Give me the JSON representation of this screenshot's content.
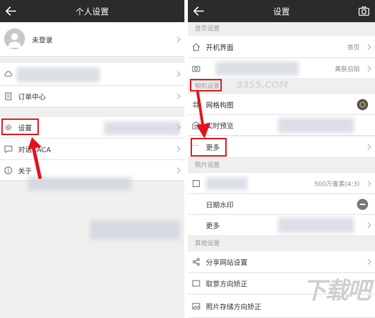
{
  "left": {
    "title": "个人设置",
    "login_text": "未登录",
    "orders": "订单中心",
    "settings": "设置",
    "chat": "对话CACA",
    "about": "关于"
  },
  "right": {
    "title": "设置",
    "section_home": "首页设置",
    "boot_screen": "开机界面",
    "boot_screen_value": "首页",
    "beauty_value": "美肤自拍",
    "section_camera": "相机设置",
    "grid": "网格构图",
    "live_preview": "实时预览",
    "more1": "更多",
    "section_photo": "照片设置",
    "photo_size_value": "500万像素(4:3)",
    "date_stamp": "日期水印",
    "more2": "更多",
    "section_other": "其他设置",
    "share_site": "分享网站设置",
    "frame_direction": "取景方向矫正",
    "storage_direction": "照片存储方向矫正"
  },
  "watermark": {
    "site": "3355.COM",
    "brand": "下载吧"
  },
  "colors": {
    "header": "#2b2b2b",
    "highlight": "#e0141c",
    "background": "#efefef"
  }
}
